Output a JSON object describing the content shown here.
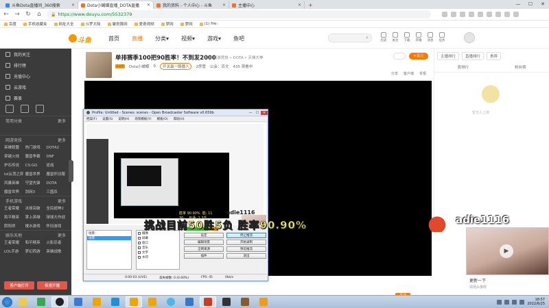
{
  "browser": {
    "tabs": [
      {
        "label": "斗鱼Dota直播间_360搜索",
        "active": false,
        "color": "blue"
      },
      {
        "label": "Dota小蝴蝶直播_DOTA直播",
        "active": true,
        "color": "orange"
      },
      {
        "label": "我的资料 - 个人中心 - 斗鱼",
        "active": false,
        "color": "orange"
      },
      {
        "label": "主播中心",
        "active": false,
        "color": "orange"
      }
    ],
    "url": "https://www.douyu.com/5532379",
    "bookmarks": [
      "百度",
      "手机收藏夹",
      "网址大全",
      "斗罗大陆",
      "聚划算网",
      "爱奇视频",
      "梦网",
      "梦网",
      "(1) file:"
    ]
  },
  "site": {
    "logo_text": "斗鱼",
    "nav": [
      {
        "label": "首页",
        "active": false
      },
      {
        "label": "直播",
        "active": true
      },
      {
        "label": "分类▾",
        "active": false
      },
      {
        "label": "视频▾",
        "active": false
      },
      {
        "label": "游戏▾",
        "active": false
      },
      {
        "label": "鱼吧",
        "active": false
      }
    ],
    "search_icon": "search-icon",
    "top_icons": [
      "历史",
      "关注",
      "下载",
      "开播",
      "消息",
      "任务"
    ]
  },
  "sidebar": {
    "items": [
      "我的关注",
      "排行榜",
      "充值中心",
      "云游戏",
      "赛事"
    ],
    "section_common": {
      "title": "常用分类",
      "more": "更多"
    },
    "section_games": {
      "title": "网游竞技",
      "more": "更多",
      "items": [
        "英雄联盟",
        "热门游戏",
        "DOTA2",
        "穿越火线",
        "魔兽争霸",
        "DNF",
        "炉石传说",
        "CS:GO",
        "逆战",
        "lol云顶之弈",
        "魔兽世界",
        "魔兽怀旧服",
        "风暴英雄",
        "守望先锋",
        "DOTA",
        "魔兽世界",
        "剑网3",
        "三国杀"
      ]
    },
    "section_mobile": {
      "title": "手机游戏",
      "more": "更多",
      "items": [
        "王者荣耀",
        "冰球突破",
        "全民超神2",
        "和平精英",
        "掌上英雄",
        "球球大作战",
        "阴阳师",
        "楼水游戏",
        "怀旧游戏"
      ]
    },
    "section_fun": {
      "title": "娱乐天地",
      "more": "更多",
      "items": [
        "王者荣耀",
        "和平精英",
        "火影忍者",
        "LOL手游",
        "梦幻西游",
        "英雄战歌"
      ]
    },
    "bottom_buttons": [
      "客户端打开",
      "极速开播"
    ]
  },
  "room": {
    "title": "单排赛季100把90胜率！不到发2000",
    "tag": "网游  网游竞技 • DOTA • 天梯大神",
    "level": "Lv2",
    "streamer": "Dota小蝴蝶",
    "hot": "0",
    "follow_badge": "开关最一路播人",
    "stats": [
      "2房管",
      "公会：百文",
      "435 观看中"
    ],
    "follow_label": "+关注",
    "tools": [
      "分享",
      "客户端",
      "举报"
    ]
  },
  "stream": {
    "overlay_text": "挑战目前50胜5负  胜率90.90%",
    "crab_name": "adie1116",
    "cam_caption_1": "更新一下",
    "cam_caption_2": "现场头像呀"
  },
  "obs": {
    "title": "Profile: Untitled - Scenes: scenes - Open Broadcaster Software v0.659b",
    "menu": [
      "档案(F)",
      "设置(S)",
      "说明(H)",
      "场景模板(Y)",
      "模板(O)",
      "帮助(H)"
    ],
    "preview_yellow": "挑战目前50胜5负 胜率90.90%",
    "preview_stats": "胜率 90.90%  胜: 11\n30     负场: 1.3千",
    "preview_name": "adie1116",
    "scenes_header": "场景：",
    "scene_selected": "场景",
    "sources": [
      "摄像",
      "屏幕",
      "窗口",
      "音乐",
      "文字",
      "水印"
    ],
    "buttons": [
      {
        "label": "设定",
        "hl": false
      },
      {
        "label": "停止推流",
        "hl": true
      },
      {
        "label": "编辑场景",
        "hl": false
      },
      {
        "label": "开始录制",
        "hl": false
      },
      {
        "label": "全网来源",
        "hl": false
      },
      {
        "label": "预览推流",
        "hl": false
      },
      {
        "label": "插件",
        "hl": false
      },
      {
        "label": "退出",
        "hl": false
      }
    ],
    "status": [
      "0:00:03 (LIVE)",
      "丢失帧数: 0 (0.00%)",
      "FPS: 45",
      "0kb/s"
    ]
  },
  "rpanel": {
    "head": [
      "主播排行",
      "直播排行",
      "贵宾"
    ],
    "tabs": [
      "周排行",
      "粉丝榜"
    ],
    "img_caption": "暂无人上榜"
  },
  "chat": {
    "send_label": "发送"
  },
  "taskbar": {
    "clock_time": "18:57",
    "clock_date": "2022/6/25"
  }
}
